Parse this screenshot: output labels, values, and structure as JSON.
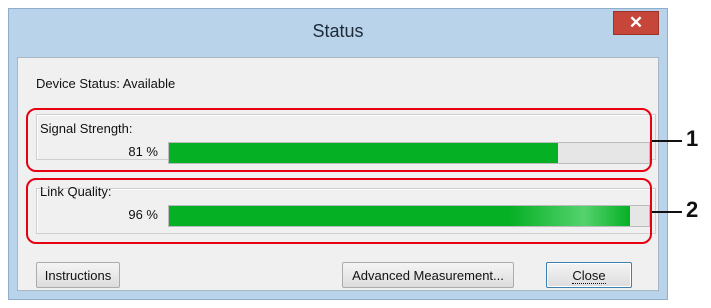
{
  "window": {
    "title": "Status"
  },
  "device_status": "Device Status: Available",
  "signal": {
    "label": "Signal Strength:",
    "percent_text": "81 %",
    "value": 0.81
  },
  "link": {
    "label": "Link Quality:",
    "percent_text": "96 %",
    "value": 0.96
  },
  "buttons": {
    "instructions": "Instructions",
    "advanced": "Advanced Measurement...",
    "close": "Close"
  },
  "callouts": [
    "1",
    "2"
  ],
  "colors": {
    "progress": "#06b025",
    "callout_border": "#e60012",
    "titlebar": "#b9d3ea",
    "close_button": "#c7463a"
  },
  "icons": {
    "window_close": "close-icon"
  }
}
